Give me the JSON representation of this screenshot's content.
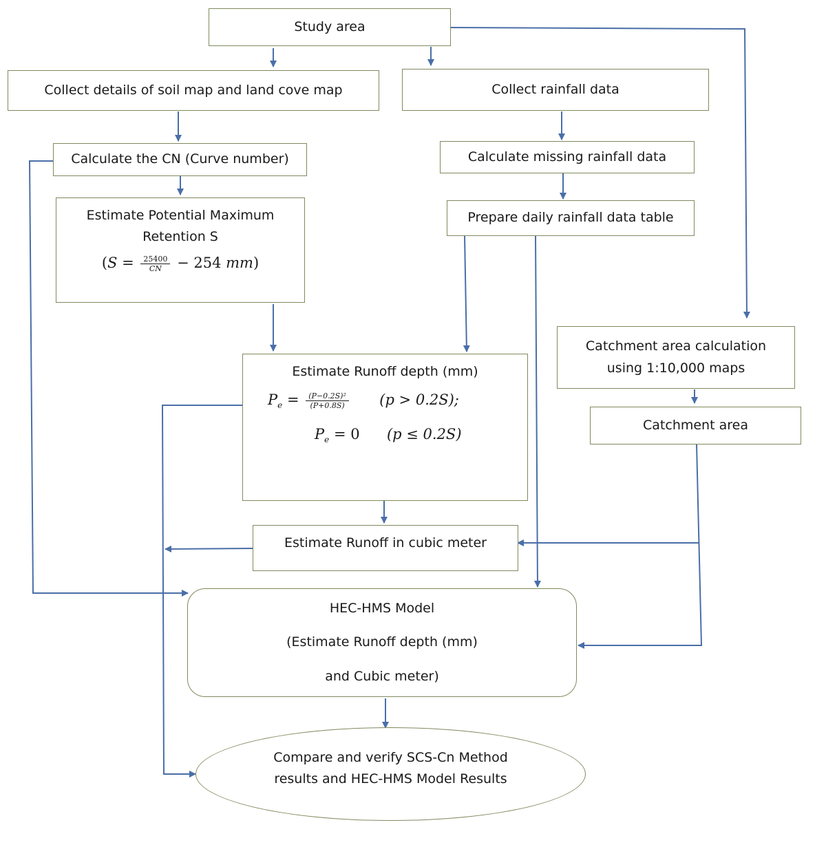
{
  "diagram": {
    "colors": {
      "box_border": "#7f8a5e",
      "connector": "#4a6ea8",
      "text": "#1a1a1a"
    },
    "nodes": {
      "study_area": {
        "label": "Study area"
      },
      "collect_soil": {
        "label": "Collect details of soil map and land cove map"
      },
      "collect_rainfall": {
        "label": "Collect rainfall data"
      },
      "calc_cn": {
        "label": "Calculate the CN (Curve number)"
      },
      "calc_missing": {
        "label": "Calculate missing rainfall data"
      },
      "prepare_daily": {
        "label": "Prepare daily rainfall data table"
      },
      "estimate_s": {
        "line1": "Estimate Potential Maximum",
        "line2": "Retention S",
        "formula": {
          "open": "(",
          "lhs": "S",
          "eq": "=",
          "numerator": "25400",
          "denominator": "CN",
          "minus": "− 254",
          "unit": "mm",
          "close": ")"
        }
      },
      "catchment_calc": {
        "line1": "Catchment area calculation",
        "line2": "using 1:10,000 maps"
      },
      "catchment_area": {
        "label": "Catchment area"
      },
      "runoff_depth": {
        "title": "Estimate Runoff depth (mm)",
        "formula1": {
          "lhs": "P",
          "lhs_sub": "e",
          "eq": "=",
          "numerator": "(P−0.2S)²",
          "denominator": "(P+0.8S)",
          "condition": "(p > 0.2S);"
        },
        "formula2": {
          "lhs": "P",
          "lhs_sub": "e",
          "eq": "= 0",
          "condition": "(p ≤ 0.2S)"
        }
      },
      "runoff_cubic": {
        "label": "Estimate Runoff in cubic meter"
      },
      "hec_hms": {
        "line1": "HEC-HMS Model",
        "line2": "(Estimate Runoff depth (mm)",
        "line3": "and Cubic meter)"
      },
      "compare": {
        "line1": "Compare and verify SCS-Cn Method",
        "line2": "results and HEC-HMS Model Results"
      }
    },
    "edges": [
      {
        "from": "study_area",
        "to": "collect_soil"
      },
      {
        "from": "study_area",
        "to": "collect_rainfall"
      },
      {
        "from": "study_area",
        "to": "catchment_calc"
      },
      {
        "from": "collect_soil",
        "to": "calc_cn"
      },
      {
        "from": "calc_cn",
        "to": "estimate_s"
      },
      {
        "from": "calc_cn",
        "to": "hec_hms"
      },
      {
        "from": "collect_rainfall",
        "to": "calc_missing"
      },
      {
        "from": "calc_missing",
        "to": "prepare_daily"
      },
      {
        "from": "prepare_daily",
        "to": "runoff_depth"
      },
      {
        "from": "prepare_daily",
        "to": "hec_hms"
      },
      {
        "from": "estimate_s",
        "to": "runoff_depth"
      },
      {
        "from": "runoff_depth",
        "to": "runoff_cubic"
      },
      {
        "from": "runoff_depth",
        "to": "compare"
      },
      {
        "from": "runoff_cubic",
        "to": "compare"
      },
      {
        "from": "catchment_calc",
        "to": "catchment_area"
      },
      {
        "from": "catchment_area",
        "to": "runoff_cubic"
      },
      {
        "from": "catchment_area",
        "to": "hec_hms"
      },
      {
        "from": "hec_hms",
        "to": "compare"
      }
    ]
  }
}
